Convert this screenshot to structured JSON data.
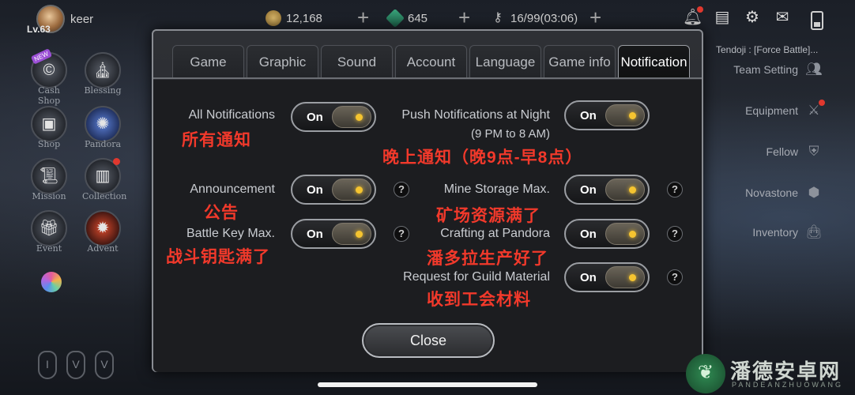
{
  "player": {
    "name": "keer",
    "level": "Lv.63"
  },
  "resources": [
    {
      "icon": "coin-icon",
      "value": "12,168"
    },
    {
      "icon": "gem-icon",
      "value": "645"
    },
    {
      "icon": "key-icon",
      "value": "16/99(03:06)"
    }
  ],
  "plus_symbol": "+",
  "top_icons": [
    "bell-icon",
    "chat-icon",
    "gear-icon",
    "mail-icon"
  ],
  "left_menu": [
    {
      "label": "Cash Shop",
      "icon": "cash-shop-icon",
      "badge": "NEW"
    },
    {
      "label": "Blessing",
      "icon": "blessing-icon"
    },
    {
      "label": "Shop",
      "icon": "chest-icon"
    },
    {
      "label": "Pandora",
      "icon": "pandora-icon"
    },
    {
      "label": "Mission",
      "icon": "scroll-icon"
    },
    {
      "label": "Collection",
      "icon": "book-icon"
    },
    {
      "label": "Event",
      "icon": "gift-icon"
    },
    {
      "label": "Advent",
      "icon": "advent-icon"
    }
  ],
  "right_menu": {
    "banner": "Tendoji : [Force Battle]...",
    "items": [
      "Team Setting",
      "Equipment",
      "Fellow",
      "Novastone",
      "Inventory"
    ]
  },
  "bottom_glyphs": [
    "I",
    "V",
    "V"
  ],
  "dialog": {
    "tabs": [
      "Game",
      "Graphic",
      "Sound",
      "Account",
      "Language",
      "Game info",
      "Notification"
    ],
    "active_tab": "Notification",
    "settings": {
      "all_notifications": {
        "label": "All Notifications",
        "value": "On",
        "annotation": "所有通知"
      },
      "push_night": {
        "label": "Push Notifications at Night",
        "sub": "(9 PM to 8 AM)",
        "value": "On",
        "annotation": "晚上通知（晚9点-早8点）"
      },
      "announcement": {
        "label": "Announcement",
        "value": "On",
        "annotation": "公告"
      },
      "mine_storage": {
        "label": "Mine Storage Max.",
        "value": "On",
        "annotation": "矿场资源满了"
      },
      "battle_key": {
        "label": "Battle Key Max.",
        "value": "On",
        "annotation": "战斗钥匙满了"
      },
      "crafting": {
        "label": "Crafting at Pandora",
        "value": "On",
        "annotation": "潘多拉生产好了"
      },
      "guild_material": {
        "label": "Request for Guild Material",
        "value": "On",
        "annotation": "收到工会材料"
      }
    },
    "help_symbol": "?",
    "close_label": "Close"
  },
  "watermark": {
    "title": "潘德安卓网",
    "subtitle": "PANDEANZHUOWANG"
  }
}
